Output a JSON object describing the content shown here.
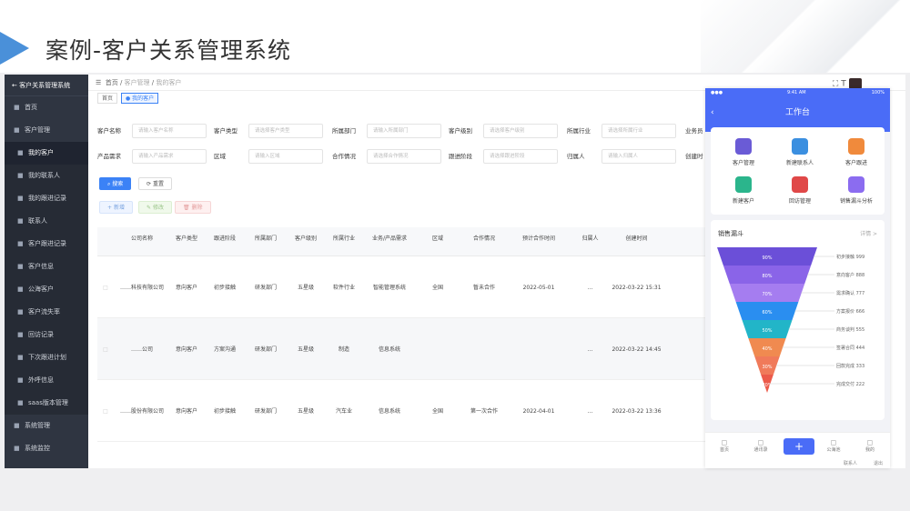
{
  "slide": {
    "title": "案例-客户关系管理系统"
  },
  "sidebar": {
    "header": "客户关系管理系统",
    "items": [
      {
        "label": "首页",
        "icon": "home-icon"
      },
      {
        "label": "客户管理",
        "icon": "customer-icon"
      },
      {
        "label": "我的客户",
        "icon": "user-icon"
      },
      {
        "label": "我的联系人",
        "icon": "contact-icon"
      },
      {
        "label": "我的跟进记录",
        "icon": "record-icon"
      },
      {
        "label": "联系人",
        "icon": "person-icon"
      },
      {
        "label": "客户跟进记录",
        "icon": "list-icon"
      },
      {
        "label": "客户信息",
        "icon": "info-icon"
      },
      {
        "label": "公海客户",
        "icon": "pool-icon"
      },
      {
        "label": "客户流失率",
        "icon": "rate-icon"
      },
      {
        "label": "回访记录",
        "icon": "visit-icon"
      },
      {
        "label": "下次跟进计划",
        "icon": "plan-icon"
      },
      {
        "label": "外呼信息",
        "icon": "call-icon"
      },
      {
        "label": "saas版本管理",
        "icon": "version-icon"
      },
      {
        "label": "系统管理",
        "icon": "settings-icon"
      },
      {
        "label": "系统监控",
        "icon": "monitor-icon"
      }
    ]
  },
  "topbar": {
    "breadcrumb1": "首页",
    "breadcrumb2": "客户管理",
    "breadcrumb3": "我的客户"
  },
  "tags": {
    "home": "首页",
    "current": "我的客户"
  },
  "filters": {
    "row1": [
      {
        "label": "客户名称",
        "placeholder": "请输入客户名称"
      },
      {
        "label": "客户类型",
        "placeholder": "请选择客户类型"
      },
      {
        "label": "所属部门",
        "placeholder": "请输入所属部门"
      },
      {
        "label": "客户级别",
        "placeholder": "请选择客户级别"
      },
      {
        "label": "所属行业",
        "placeholder": "请选择所属行业"
      },
      {
        "label": "业务员",
        "placeholder": ""
      }
    ],
    "row2": [
      {
        "label": "产品需求",
        "placeholder": "请输入产品需求"
      },
      {
        "label": "区域",
        "placeholder": "请输入区域"
      },
      {
        "label": "合作情况",
        "placeholder": "请选择合作情况"
      },
      {
        "label": "跟进阶段",
        "placeholder": "请选择跟进阶段"
      },
      {
        "label": "归属人",
        "placeholder": "请输入归属人"
      },
      {
        "label": "创建时",
        "placeholder": ""
      }
    ]
  },
  "buttons": {
    "search": "搜索",
    "reset": "重置",
    "add": "新增",
    "edit": "修改",
    "delete": "删除"
  },
  "table": {
    "headers": [
      "公司名称",
      "客户类型",
      "跟进阶段",
      "所属部门",
      "客户级别",
      "所属行业",
      "业务/产品需求",
      "区域",
      "合作情况",
      "预计合作时间",
      "归属人",
      "创建时间"
    ],
    "rows": [
      [
        "……科技有限公司",
        "意向客户",
        "初步接触",
        "研发部门",
        "五星级",
        "软件行业",
        "智能管理系统",
        "全国",
        "暂未合作",
        "2022-05-01",
        "…",
        "2022-03-22 15:31"
      ],
      [
        "……公司",
        "意向客户",
        "方案沟通",
        "研发部门",
        "五星级",
        "制造",
        "信息系统",
        "",
        "",
        "",
        "…",
        "2022-03-22 14:45"
      ],
      [
        "……股份有限公司",
        "意向客户",
        "初步接触",
        "研发部门",
        "五星级",
        "汽车业",
        "信息系统",
        "全国",
        "第一次合作",
        "2022-04-01",
        "…",
        "2022-03-22 13:36"
      ]
    ]
  },
  "phone": {
    "status_left": "●●●",
    "status_mid": "9:41 AM",
    "status_right": "100%",
    "title": "工作台",
    "quick": [
      {
        "label": "客户管理",
        "color": "#6a5bd6"
      },
      {
        "label": "新建联系人",
        "color": "#3b8fe0"
      },
      {
        "label": "客户跟进",
        "color": "#f08a3c"
      },
      {
        "label": "新建客户",
        "color": "#2bb58c"
      },
      {
        "label": "回访管理",
        "color": "#e04848"
      },
      {
        "label": "销售漏斗分析",
        "color": "#8b6cf0"
      }
    ],
    "funnel_title": "销售漏斗",
    "funnel_more": "详情 >",
    "funnel": [
      {
        "label": "初步接触 999",
        "pct": "90%",
        "color": "#6b4fd8"
      },
      {
        "label": "意向客户 888",
        "pct": "80%",
        "color": "#8a64e8"
      },
      {
        "label": "需求确认 777",
        "pct": "70%",
        "color": "#a57df0"
      },
      {
        "label": "方案报价 666",
        "pct": "60%",
        "color": "#2a8ef0"
      },
      {
        "label": "商务谈判 555",
        "pct": "50%",
        "color": "#22b5c8"
      },
      {
        "label": "签署合同 444",
        "pct": "40%",
        "color": "#f08a50"
      },
      {
        "label": "回款完成 333",
        "pct": "30%",
        "color": "#f07a5a"
      },
      {
        "label": "完成交付 222",
        "pct": "20%",
        "color": "#ec5a4a"
      }
    ],
    "nav": [
      "首页",
      "通讯录",
      "",
      "公海池",
      "我的"
    ],
    "footer1": "联系人",
    "footer2": "退出"
  }
}
